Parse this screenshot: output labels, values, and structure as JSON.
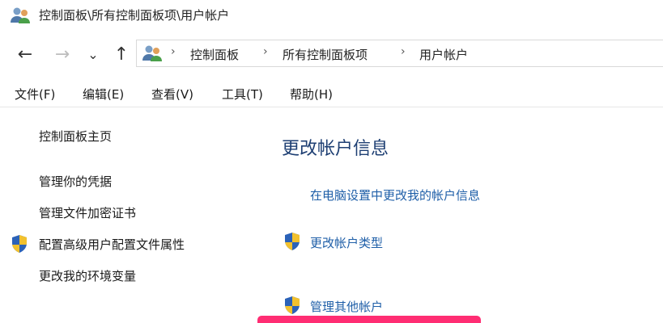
{
  "window": {
    "title": "控制面板\\所有控制面板项\\用户帐户"
  },
  "icons": {
    "users": "users-icon",
    "shield": "uac-shield-icon"
  },
  "nav": {
    "back": "←",
    "forward": "→",
    "recent": "⌄",
    "up": "↑"
  },
  "address": {
    "separator": "›",
    "crumbs": [
      "控制面板",
      "所有控制面板项",
      "用户帐户"
    ]
  },
  "menu": {
    "items": [
      "文件(F)",
      "编辑(E)",
      "查看(V)",
      "工具(T)",
      "帮助(H)"
    ]
  },
  "leftnav": {
    "items": [
      "控制面板主页",
      "管理你的凭据",
      "管理文件加密证书",
      "配置高级用户配置文件属性",
      "更改我的环境变量"
    ]
  },
  "main": {
    "heading": "更改帐户信息",
    "links": [
      "在电脑设置中更改我的帐户信息",
      "更改帐户类型",
      "管理其他帐户"
    ]
  },
  "colors": {
    "heading": "#1e3f73",
    "link": "#1f5fa8",
    "highlight": "#ff2d73"
  }
}
